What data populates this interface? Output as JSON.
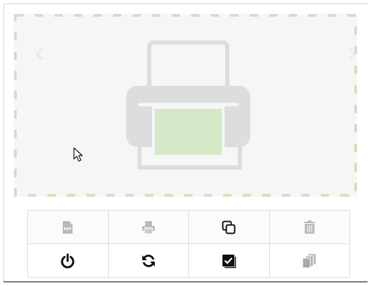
{
  "drop_zone": {
    "prev_icon": "chevron-left-icon",
    "next_icon": "chevron-right-icon",
    "illustration": "scanner-icon",
    "border_color": "#cfe2c2",
    "paper_color": "#d5e8c8"
  },
  "toolbar": {
    "buttons": [
      {
        "icon": "pdf-icon",
        "state": "disabled",
        "label": "PDF"
      },
      {
        "icon": "printer-icon",
        "state": "disabled"
      },
      {
        "icon": "copy-icon",
        "state": "enabled"
      },
      {
        "icon": "trash-icon",
        "state": "disabled"
      },
      {
        "icon": "power-icon",
        "state": "enabled"
      },
      {
        "icon": "refresh-icon",
        "state": "enabled"
      },
      {
        "icon": "select-all-checkbox-icon",
        "state": "enabled"
      },
      {
        "icon": "pages-stack-icon",
        "state": "disabled"
      }
    ]
  },
  "colors": {
    "icon_enabled": "#111111",
    "icon_disabled": "#b9b9b9",
    "scanner_gray": "#dcdedd"
  }
}
